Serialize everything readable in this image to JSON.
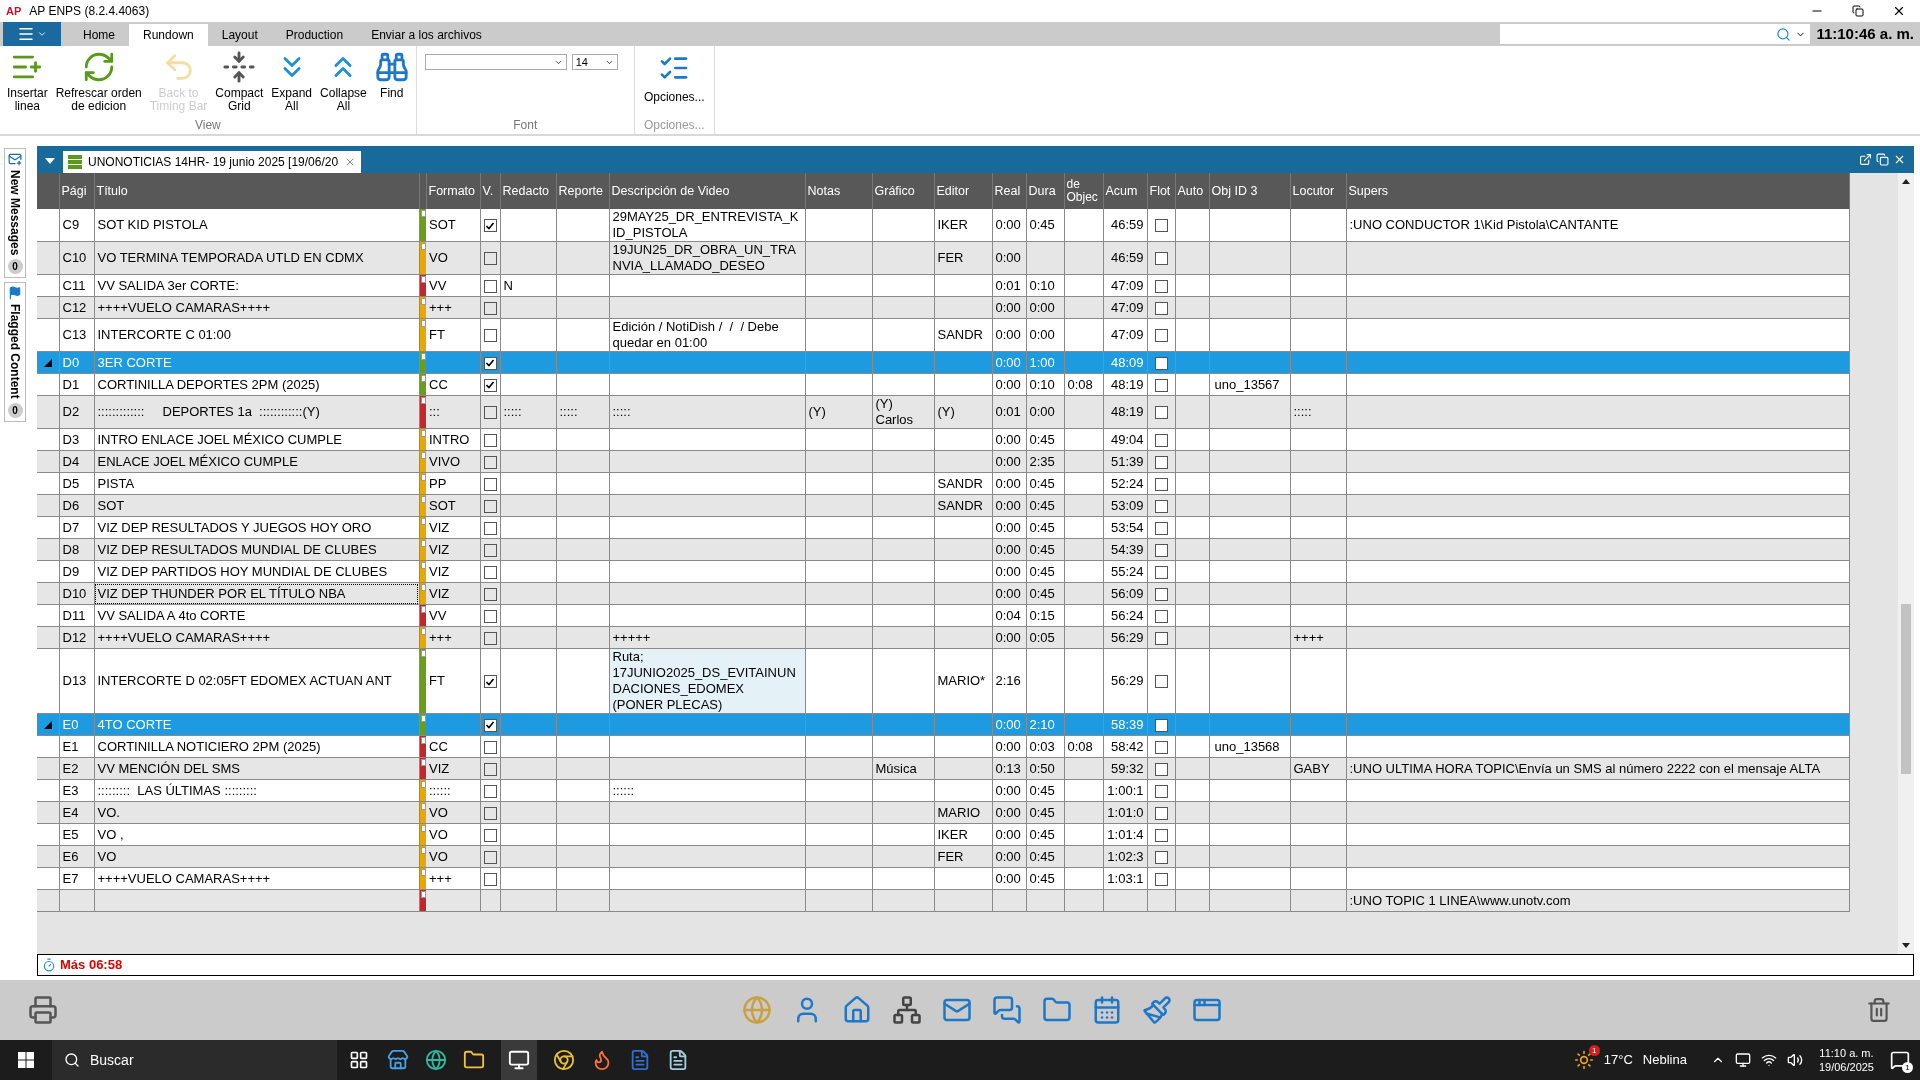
{
  "window": {
    "logo": "AP",
    "title": "AP ENPS (8.2.4.4063)"
  },
  "ribbon": {
    "tabs": [
      {
        "label": "Home",
        "selected": false
      },
      {
        "label": "Rundown",
        "selected": true
      },
      {
        "label": "Layout",
        "selected": false
      },
      {
        "label": "Production",
        "selected": false
      },
      {
        "label": "Enviar a los archivos",
        "selected": false
      }
    ],
    "clock": "11:10:46 a. m.",
    "view_buttons": [
      {
        "label": "Insertar\nlinea",
        "disabled": false
      },
      {
        "label": "Refrescar orden\nde edicion",
        "disabled": false
      },
      {
        "label": "Back to\nTiming Bar",
        "disabled": true
      },
      {
        "label": "Compact\nGrid",
        "disabled": false
      },
      {
        "label": "Expand\nAll",
        "disabled": false
      },
      {
        "label": "Collapse\nAll",
        "disabled": false
      },
      {
        "label": "Find",
        "disabled": false
      }
    ],
    "view_label": "View",
    "font_size": "14",
    "font_label": "Font",
    "options_button": "Opciones...",
    "options_label": "Opciones..."
  },
  "side_panel": [
    {
      "label": "New Messages",
      "count": "0"
    },
    {
      "label": "Flagged Content",
      "count": "0"
    }
  ],
  "document": {
    "tab": "UNONOTICIAS 14HR- 19 junio 2025 [19/06/20",
    "columns": [
      "Pági",
      "Título",
      "",
      "Formato",
      "V.",
      "Redacto",
      "Reporte",
      "Descripción de Video",
      "Notas",
      "Gráfico",
      "Editor",
      "Real",
      "Dura",
      "de Objec",
      "Acum",
      "Flot",
      "Auto",
      "Obj ID 3",
      "Locutor",
      "Supers"
    ],
    "rows": [
      {
        "kind": "story",
        "focused": false,
        "page": "C9",
        "title": "SOT KID PISTOLA",
        "color": "#6b9c1c",
        "format": "SOT",
        "v": true,
        "redactor": "",
        "reportero": "",
        "desc": "29MAY25_DR_ENTREVISTA_KID_PISTOLA",
        "notas": "",
        "grafico": "",
        "editor": "IKER",
        "real": "0:00",
        "dur": "0:45",
        "obj": "",
        "acum": "46:59",
        "flot": false,
        "objid": "",
        "locutor": "",
        "supers": ":UNO CONDUCTOR 1\\Kid Pistola\\CANTANTE"
      },
      {
        "kind": "story",
        "focused": false,
        "page": "C10",
        "title": "VO TERMINA TEMPORADA UTLD EN CDMX",
        "color": "#e8a800",
        "format": "VO",
        "v": false,
        "redactor": "",
        "reportero": "",
        "desc": "19JUN25_DR_OBRA_UN_TRANVIA_LLAMADO_DESEO",
        "notas": "",
        "grafico": "",
        "editor": "FER",
        "real": "0:00",
        "dur": "",
        "obj": "",
        "acum": "46:59",
        "flot": false,
        "objid": "",
        "locutor": "",
        "supers": ""
      },
      {
        "kind": "story",
        "focused": false,
        "page": "C11",
        "title": "VV SALIDA 3er CORTE:",
        "color": "#c0282d",
        "format": "VV",
        "v": false,
        "redactor": "N",
        "reportero": "",
        "desc": "",
        "notas": "",
        "grafico": "",
        "editor": "",
        "real": "0:01",
        "dur": "0:10",
        "obj": "",
        "acum": "47:09",
        "flot": false,
        "objid": "",
        "locutor": "",
        "supers": ""
      },
      {
        "kind": "story",
        "focused": false,
        "page": "C12",
        "title": "++++VUELO CAMARAS++++",
        "color": "#e8a800",
        "format": "+++",
        "v": false,
        "redactor": "",
        "reportero": "",
        "desc": "",
        "notas": "",
        "grafico": "",
        "editor": "",
        "real": "0:00",
        "dur": "0:00",
        "obj": "",
        "acum": "47:09",
        "flot": false,
        "objid": "",
        "locutor": "",
        "supers": ""
      },
      {
        "kind": "story",
        "focused": false,
        "page": "C13",
        "title": "INTERCORTE C 01:00",
        "color": "#e8a800",
        "format": "FT",
        "v": false,
        "redactor": "",
        "reportero": "",
        "desc": "Edición / NotiDish /  /  / Debe quedar en 01:00",
        "notas": "",
        "grafico": "",
        "editor": "SANDR",
        "real": "0:00",
        "dur": "0:00",
        "obj": "",
        "acum": "47:09",
        "flot": false,
        "objid": "",
        "locutor": "",
        "supers": ""
      },
      {
        "kind": "break",
        "focused": false,
        "page": "D0",
        "title": "3ER CORTE",
        "color": "#6b9c1c",
        "format": "",
        "v": true,
        "redactor": "",
        "reportero": "",
        "desc": "",
        "notas": "",
        "grafico": "",
        "editor": "",
        "real": "0:00",
        "dur": "1:00",
        "obj": "",
        "acum": "48:09",
        "flot": false,
        "objid": "",
        "locutor": "",
        "supers": ""
      },
      {
        "kind": "story",
        "focused": false,
        "page": "D1",
        "title": "CORTINILLA DEPORTES 2PM (2025)",
        "color": "#6b9c1c",
        "format": "CC",
        "v": true,
        "redactor": "",
        "reportero": "",
        "desc": "",
        "notas": "",
        "grafico": "",
        "editor": "",
        "real": "0:00",
        "dur": "0:10",
        "obj": "0:08",
        "acum": "48:19",
        "flot": false,
        "objid": "uno_13567",
        "locutor": "",
        "supers": ""
      },
      {
        "kind": "story",
        "focused": false,
        "page": "D2",
        "title": ":::::::::::::     DEPORTES 1a  ::::::::::::(Y)",
        "color": "#c0282d",
        "format": ":::",
        "v": false,
        "redactor": ":::::",
        "reportero": ":::::",
        "desc": ":::::",
        "notas": "(Y)",
        "grafico": "(Y)\nCarlos",
        "editor": "(Y)",
        "real": "0:01",
        "dur": "0:00",
        "obj": "",
        "acum": "48:19",
        "flot": false,
        "objid": "",
        "locutor": ":::::",
        "supers": ""
      },
      {
        "kind": "story",
        "focused": false,
        "page": "D3",
        "title": "INTRO ENLACE JOEL MÉXICO CUMPLE",
        "color": "#e8a800",
        "format": "INTRO",
        "v": false,
        "redactor": "",
        "reportero": "",
        "desc": "",
        "notas": "",
        "grafico": "",
        "editor": "",
        "real": "0:00",
        "dur": "0:45",
        "obj": "",
        "acum": "49:04",
        "flot": false,
        "objid": "",
        "locutor": "",
        "supers": ""
      },
      {
        "kind": "story",
        "focused": false,
        "page": "D4",
        "title": "ENLACE JOEL MÉXICO CUMPLE",
        "color": "#e8a800",
        "format": "VIVO",
        "v": false,
        "redactor": "",
        "reportero": "",
        "desc": "",
        "notas": "",
        "grafico": "",
        "editor": "",
        "real": "0:00",
        "dur": "2:35",
        "obj": "",
        "acum": "51:39",
        "flot": false,
        "objid": "",
        "locutor": "",
        "supers": ""
      },
      {
        "kind": "story",
        "focused": false,
        "page": "D5",
        "title": "PISTA",
        "color": "#e8a800",
        "format": "PP",
        "v": false,
        "redactor": "",
        "reportero": "",
        "desc": "",
        "notas": "",
        "grafico": "",
        "editor": "SANDR",
        "real": "0:00",
        "dur": "0:45",
        "obj": "",
        "acum": "52:24",
        "flot": false,
        "objid": "",
        "locutor": "",
        "supers": ""
      },
      {
        "kind": "story",
        "focused": false,
        "page": "D6",
        "title": "SOT",
        "color": "#e8a800",
        "format": "SOT",
        "v": false,
        "redactor": "",
        "reportero": "",
        "desc": "",
        "notas": "",
        "grafico": "",
        "editor": "SANDR",
        "real": "0:00",
        "dur": "0:45",
        "obj": "",
        "acum": "53:09",
        "flot": false,
        "objid": "",
        "locutor": "",
        "supers": ""
      },
      {
        "kind": "story",
        "focused": false,
        "page": "D7",
        "title": "VIZ DEP RESULTADOS Y JUEGOS HOY ORO",
        "color": "#e8a800",
        "format": "VIZ",
        "v": false,
        "redactor": "",
        "reportero": "",
        "desc": "",
        "notas": "",
        "grafico": "",
        "editor": "",
        "real": "0:00",
        "dur": "0:45",
        "obj": "",
        "acum": "53:54",
        "flot": false,
        "objid": "",
        "locutor": "",
        "supers": ""
      },
      {
        "kind": "story",
        "focused": false,
        "page": "D8",
        "title": "VIZ DEP RESULTADOS MUNDIAL DE CLUBES",
        "color": "#e8a800",
        "format": "VIZ",
        "v": false,
        "redactor": "",
        "reportero": "",
        "desc": "",
        "notas": "",
        "grafico": "",
        "editor": "",
        "real": "0:00",
        "dur": "0:45",
        "obj": "",
        "acum": "54:39",
        "flot": false,
        "objid": "",
        "locutor": "",
        "supers": ""
      },
      {
        "kind": "story",
        "focused": false,
        "page": "D9",
        "title": "VIZ DEP PARTIDOS HOY MUNDIAL DE CLUBES",
        "color": "#e8a800",
        "format": "VIZ",
        "v": false,
        "redactor": "",
        "reportero": "",
        "desc": "",
        "notas": "",
        "grafico": "",
        "editor": "",
        "real": "0:00",
        "dur": "0:45",
        "obj": "",
        "acum": "55:24",
        "flot": false,
        "objid": "",
        "locutor": "",
        "supers": ""
      },
      {
        "kind": "story",
        "focused": true,
        "page": "D10",
        "title": "VIZ DEP THUNDER POR EL TÍTULO NBA",
        "color": "#e8a800",
        "format": "VIZ",
        "v": false,
        "redactor": "",
        "reportero": "",
        "desc": "",
        "notas": "",
        "grafico": "",
        "editor": "",
        "real": "0:00",
        "dur": "0:45",
        "obj": "",
        "acum": "56:09",
        "flot": false,
        "objid": "",
        "locutor": "",
        "supers": ""
      },
      {
        "kind": "story",
        "focused": false,
        "page": "D11",
        "title": "VV SALIDA A 4to CORTE",
        "color": "#c0282d",
        "format": "VV",
        "v": false,
        "redactor": "",
        "reportero": "",
        "desc": "",
        "notas": "",
        "grafico": "",
        "editor": "",
        "real": "0:04",
        "dur": "0:15",
        "obj": "",
        "acum": "56:24",
        "flot": false,
        "objid": "",
        "locutor": "",
        "supers": ""
      },
      {
        "kind": "story",
        "focused": false,
        "page": "D12",
        "title": "++++VUELO CAMARAS++++",
        "color": "#e8a800",
        "format": "+++",
        "v": false,
        "redactor": "",
        "reportero": "",
        "desc": "+++++",
        "notas": "",
        "grafico": "",
        "editor": "",
        "real": "0:00",
        "dur": "0:05",
        "obj": "",
        "acum": "56:29",
        "flot": false,
        "objid": "",
        "locutor": "++++",
        "supers": ""
      },
      {
        "kind": "story",
        "focused": false,
        "page": "D13",
        "title": "INTERCORTE D 02:05FT EDOMEX ACTUAN ANT",
        "color": "#6b9c1c",
        "format": "FT",
        "v": true,
        "redactor": "",
        "reportero": "",
        "desc": "Ruta;\n17JUNIO2025_DS_EVITAINUNDACIONES_EDOMEX\n(PONER PLECAS)",
        "notas": "",
        "grafico": "",
        "editor": "MARIO*",
        "real": "2:16",
        "dur": "",
        "obj": "",
        "acum": "56:29",
        "flot": false,
        "objid": "",
        "locutor": "",
        "supers": ""
      },
      {
        "kind": "break",
        "focused": false,
        "page": "E0",
        "title": "4TO CORTE",
        "color": "#6b9c1c",
        "format": "",
        "v": true,
        "redactor": "",
        "reportero": "",
        "desc": "",
        "notas": "",
        "grafico": "",
        "editor": "",
        "real": "0:00",
        "dur": "2:10",
        "obj": "",
        "acum": "58:39",
        "flot": false,
        "objid": "",
        "locutor": "",
        "supers": ""
      },
      {
        "kind": "story",
        "focused": false,
        "page": "E1",
        "title": "CORTINILLA NOTICIERO 2PM (2025)",
        "color": "#c0282d",
        "format": "CC",
        "v": false,
        "redactor": "",
        "reportero": "",
        "desc": "",
        "notas": "",
        "grafico": "",
        "editor": "",
        "real": "0:00",
        "dur": "0:03",
        "obj": "0:08",
        "acum": "58:42",
        "flot": false,
        "objid": "uno_13568",
        "locutor": "",
        "supers": ""
      },
      {
        "kind": "story",
        "focused": false,
        "page": "E2",
        "title": "VV MENCIÓN DEL SMS",
        "color": "#c0282d",
        "format": "VIZ",
        "v": false,
        "redactor": "",
        "reportero": "",
        "desc": "",
        "notas": "",
        "grafico": "Música",
        "editor": "",
        "real": "0:13",
        "dur": "0:50",
        "obj": "",
        "acum": "59:32",
        "flot": false,
        "objid": "",
        "locutor": "GABY",
        "supers": ":UNO ULTIMA HORA TOPIC\\Envía un SMS al número 2222 con el mensaje ALTA"
      },
      {
        "kind": "story",
        "focused": false,
        "page": "E3",
        "title": ":::::::::  LAS ÚLTIMAS :::::::::",
        "color": "#e8a800",
        "format": "::::::",
        "v": false,
        "redactor": "",
        "reportero": "",
        "desc": "::::::",
        "notas": "",
        "grafico": "",
        "editor": "",
        "real": "0:00",
        "dur": "0:45",
        "obj": "",
        "acum": "1:00:1",
        "flot": false,
        "objid": "",
        "locutor": "",
        "supers": ""
      },
      {
        "kind": "story",
        "focused": false,
        "page": "E4",
        "title": "VO.",
        "color": "#e8a800",
        "format": "VO",
        "v": false,
        "redactor": "",
        "reportero": "",
        "desc": "",
        "notas": "",
        "grafico": "",
        "editor": "MARIO",
        "real": "0:00",
        "dur": "0:45",
        "obj": "",
        "acum": "1:01:0",
        "flot": false,
        "objid": "",
        "locutor": "",
        "supers": ""
      },
      {
        "kind": "story",
        "focused": false,
        "page": "E5",
        "title": "VO ,",
        "color": "#e8a800",
        "format": "VO",
        "v": false,
        "redactor": "",
        "reportero": "",
        "desc": "",
        "notas": "",
        "grafico": "",
        "editor": "IKER",
        "real": "0:00",
        "dur": "0:45",
        "obj": "",
        "acum": "1:01:4",
        "flot": false,
        "objid": "",
        "locutor": "",
        "supers": ""
      },
      {
        "kind": "story",
        "focused": false,
        "page": "E6",
        "title": "VO",
        "color": "#e8a800",
        "format": "VO",
        "v": false,
        "redactor": "",
        "reportero": "",
        "desc": "",
        "notas": "",
        "grafico": "",
        "editor": "FER",
        "real": "0:00",
        "dur": "0:45",
        "obj": "",
        "acum": "1:02:3",
        "flot": false,
        "objid": "",
        "locutor": "",
        "supers": ""
      },
      {
        "kind": "story",
        "focused": false,
        "page": "E7",
        "title": "++++VUELO CAMARAS++++",
        "color": "#e8a800",
        "format": "+++",
        "v": false,
        "redactor": "",
        "reportero": "",
        "desc": "",
        "notas": "",
        "grafico": "",
        "editor": "",
        "real": "0:00",
        "dur": "0:45",
        "obj": "",
        "acum": "1:03:1",
        "flot": false,
        "objid": "",
        "locutor": "",
        "supers": ""
      },
      {
        "kind": "partial",
        "focused": false,
        "page": "",
        "title": "",
        "color": "#c0282d",
        "format": "",
        "redactor": "",
        "reportero": "",
        "desc": "",
        "notas": "",
        "grafico": "",
        "editor": "",
        "real": "",
        "dur": "",
        "obj": "",
        "acum": "",
        "objid": "",
        "locutor": "",
        "supers": ":UNO TOPIC 1 LINEA\\www.unotv.com"
      }
    ],
    "status": "Más 06:58"
  },
  "taskbar": {
    "search_placeholder": "Buscar",
    "weather_badge": "1",
    "temperature": "17°C",
    "weather": "Neblina",
    "time": "11:10 a. m.",
    "date": "19/06/2025",
    "notifications": "1"
  }
}
